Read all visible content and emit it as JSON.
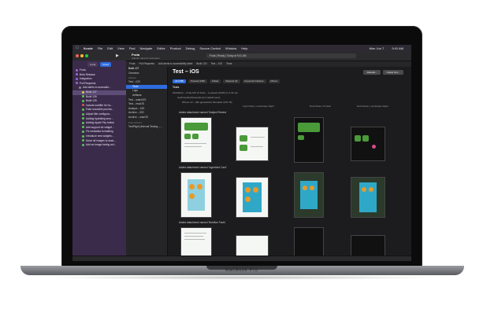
{
  "menubar": {
    "items": [
      "Xcode",
      "File",
      "Edit",
      "View",
      "Find",
      "Navigate",
      "Editor",
      "Product",
      "Debug",
      "Source Control",
      "Window",
      "Help"
    ],
    "right": [
      "Mon Jun 7",
      "9:41 AM"
    ]
  },
  "toolbar": {
    "title": "Fruta",
    "subtitle": "Add lint rules for Animation",
    "status": "Fruta | Ready | Today at 9:41 AM"
  },
  "pathbar": {
    "items": [
      "Fruta",
      "Pull Requests",
      "Add alerts to accessibility label",
      "Build 120",
      "Test – iOS",
      "Tests"
    ]
  },
  "navigator": {
    "tabs": [
      "Local",
      "Cloud"
    ],
    "rows": [
      {
        "label": "Fruta",
        "sel": false,
        "color": "#9a6ad8"
      },
      {
        "label": "Beta Release",
        "sel": false,
        "color": "#9a6ad8"
      },
      {
        "label": "Integration",
        "sel": false,
        "color": "#9a6ad8"
      },
      {
        "label": "Pull Requests",
        "sel": false,
        "color": "#9a6ad8"
      },
      {
        "label": "Add alerts to accessibi...",
        "sel": false,
        "color": "#8a8a8a"
      },
      {
        "label": "Build 127",
        "sel": true,
        "color": "#e6c84a"
      },
      {
        "label": "Build 126",
        "sel": false,
        "color": "#5ac85a"
      },
      {
        "label": "Build 125",
        "sel": false,
        "color": "#5ac85a"
      },
      {
        "label": "Include subtitle for ho...",
        "sel": false,
        "color": "#d85a5a"
      },
      {
        "label": "Fake smoothie purcha...",
        "sel": false,
        "color": "#5ac85a"
      },
      {
        "label": "Adjust title configura...",
        "sel": false,
        "color": "#5ac85a"
      },
      {
        "label": "Adding hydrating smo...",
        "sel": false,
        "color": "#5ac85a"
      },
      {
        "label": "Adding Apple Pay button",
        "sel": false,
        "color": "#5ac85a"
      },
      {
        "label": "Add support for widget...",
        "sel": false,
        "color": "#5ac85a"
      },
      {
        "label": "Fix metadata formatting",
        "sel": false,
        "color": "#5ac85a"
      },
      {
        "label": "Introduce new widgets...",
        "sel": false,
        "color": "#5ac85a"
      },
      {
        "label": "Move all images to asse...",
        "sel": false,
        "color": "#5ac85a"
      },
      {
        "label": "Add an image fading ani...",
        "sel": false,
        "color": "#5ac85a"
      }
    ]
  },
  "tests_list": {
    "top": "Build 127",
    "overview": "Overview",
    "section_actions": "Actions",
    "rows": [
      {
        "label": "Test – iOS",
        "sel": false
      },
      {
        "label": "Tests",
        "sel": true
      },
      {
        "label": "Logs",
        "sel": false
      },
      {
        "label": "Artifacts",
        "sel": false
      },
      {
        "label": "Test – watchOS",
        "sel": false
      },
      {
        "label": "Test – macOS",
        "sel": false
      },
      {
        "label": "Analyze – iOS",
        "sel": false
      },
      {
        "label": "Archive – iOS",
        "sel": false
      },
      {
        "label": "Archive – macOS",
        "sel": false
      }
    ],
    "section_post": "Post-Actions",
    "post_rows": [
      "TestFlight (Internal Testing –..."
    ]
  },
  "main": {
    "title": "Test – iOS",
    "buttons": [
      "Rebuild...",
      "Check Out..."
    ],
    "filters": [
      {
        "label": "All (188)",
        "active": true
      },
      {
        "label": "Passed (188)",
        "active": false
      },
      {
        "label": "Failed",
        "active": false
      },
      {
        "label": "Skipped (0)",
        "active": false
      },
      {
        "label": "Expected Failures",
        "active": false
      },
      {
        "label": "Mixed",
        "active": false
      }
    ],
    "tests_heading": "Tests",
    "info1": "Workflows – Fruta iOS UI Tests – 1 passed (100%) in 4.31 sec",
    "info2": "testSmoothieScreenshot()  4 attachments",
    "info3": "iPhone 12 – (4th generation) Simulator (iOS 15)",
    "columns": [
      "Light Mode | Landscape Right",
      "Dark Mode | Portrait",
      "Dark Mode | Landscape Right"
    ],
    "groups": [
      "Added attachment named 'Subject Review'",
      "Added attachment named 'Ingredient Card'",
      "Added attachment named 'Nutrition Facts'"
    ]
  },
  "device": {
    "brand": "MacBook Pro"
  },
  "colors": {
    "accent": "#2e6de0",
    "navigator": "#3b2b4a",
    "background": "#1c1c1e"
  }
}
